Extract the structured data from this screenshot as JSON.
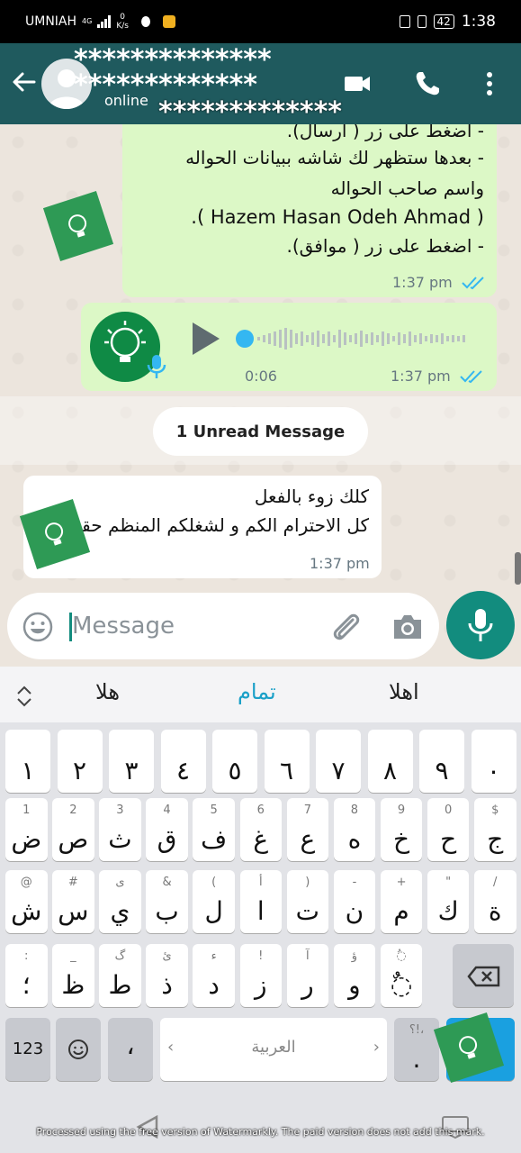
{
  "status_bar": {
    "carrier": "UMNIAH",
    "network": "4G",
    "speed_value": "0",
    "speed_unit": "K/s",
    "battery": "42",
    "time": "1:38"
  },
  "app_bar": {
    "contact_name_line1": "**************",
    "contact_name_line2": "*************",
    "contact_name_line3": "*************",
    "contact_status": "online",
    "icons": [
      "back-arrow-icon",
      "video-call-icon",
      "voice-call-icon",
      "more-options-icon"
    ]
  },
  "messages": {
    "outgoing_text": {
      "lines": [
        "- اضغط على زر ( ارسال).",
        "- بعدها ستظهر لك شاشه ببيانات الحواله",
        "واسم صاحب الحواله",
        "( Hazem Hasan Odeh Ahmad ).",
        "- اضغط على زر ( موافق)."
      ],
      "time": "1:37 pm"
    },
    "outgoing_voice": {
      "duration": "0:06",
      "time": "1:37 pm"
    },
    "unread_label": "1 Unread Message",
    "incoming_text": {
      "lines": [
        "كلك زوء بالفعل",
        "كل الاحترام الكم و لشغلكم المنظم حقيقة"
      ],
      "time": "1:37 pm"
    }
  },
  "composer": {
    "placeholder": "Message"
  },
  "keyboard": {
    "suggestions": [
      "هلا",
      "تمام",
      "اهلا"
    ],
    "row_digits": [
      "١",
      "٢",
      "٣",
      "٤",
      "٥",
      "٦",
      "٧",
      "٨",
      "٩",
      "٠"
    ],
    "row1": [
      {
        "main": "ض",
        "sub": "1"
      },
      {
        "main": "ص",
        "sub": "2"
      },
      {
        "main": "ث",
        "sub": "3"
      },
      {
        "main": "ق",
        "sub": "4"
      },
      {
        "main": "ف",
        "sub": "5"
      },
      {
        "main": "غ",
        "sub": "6"
      },
      {
        "main": "ع",
        "sub": "7"
      },
      {
        "main": "ه",
        "sub": "8"
      },
      {
        "main": "خ",
        "sub": "9"
      },
      {
        "main": "ح",
        "sub": "0"
      },
      {
        "main": "ج",
        "sub": "$"
      }
    ],
    "row2": [
      {
        "main": "ش",
        "sub": "@"
      },
      {
        "main": "س",
        "sub": "#"
      },
      {
        "main": "ي",
        "sub": "ى"
      },
      {
        "main": "ب",
        "sub": "&"
      },
      {
        "main": "ل",
        "sub": "("
      },
      {
        "main": "ا",
        "sub": "أ"
      },
      {
        "main": "ت",
        "sub": ")"
      },
      {
        "main": "ن",
        "sub": "-"
      },
      {
        "main": "م",
        "sub": "+"
      },
      {
        "main": "ك",
        "sub": "\""
      },
      {
        "main": "ة",
        "sub": "/"
      }
    ],
    "row3": [
      {
        "main": "؛",
        "sub": ":"
      },
      {
        "main": "ظ",
        "sub": "_"
      },
      {
        "main": "ط",
        "sub": "گ"
      },
      {
        "main": "ذ",
        "sub": "ئ"
      },
      {
        "main": "د",
        "sub": "ء"
      },
      {
        "main": "ز",
        "sub": "!"
      },
      {
        "main": "ر",
        "sub": "آ"
      },
      {
        "main": "و",
        "sub": "ؤ"
      },
      {
        "main": "◌ٌ",
        "sub": "◌ُ"
      }
    ],
    "key_123": "123",
    "key_comma": "،",
    "space_label": "العربية",
    "key_period": ".",
    "key_period_sub": "؟!،"
  },
  "watermark_text": "Processed using the free version of Watermarkly. The paid version does not add this mark."
}
